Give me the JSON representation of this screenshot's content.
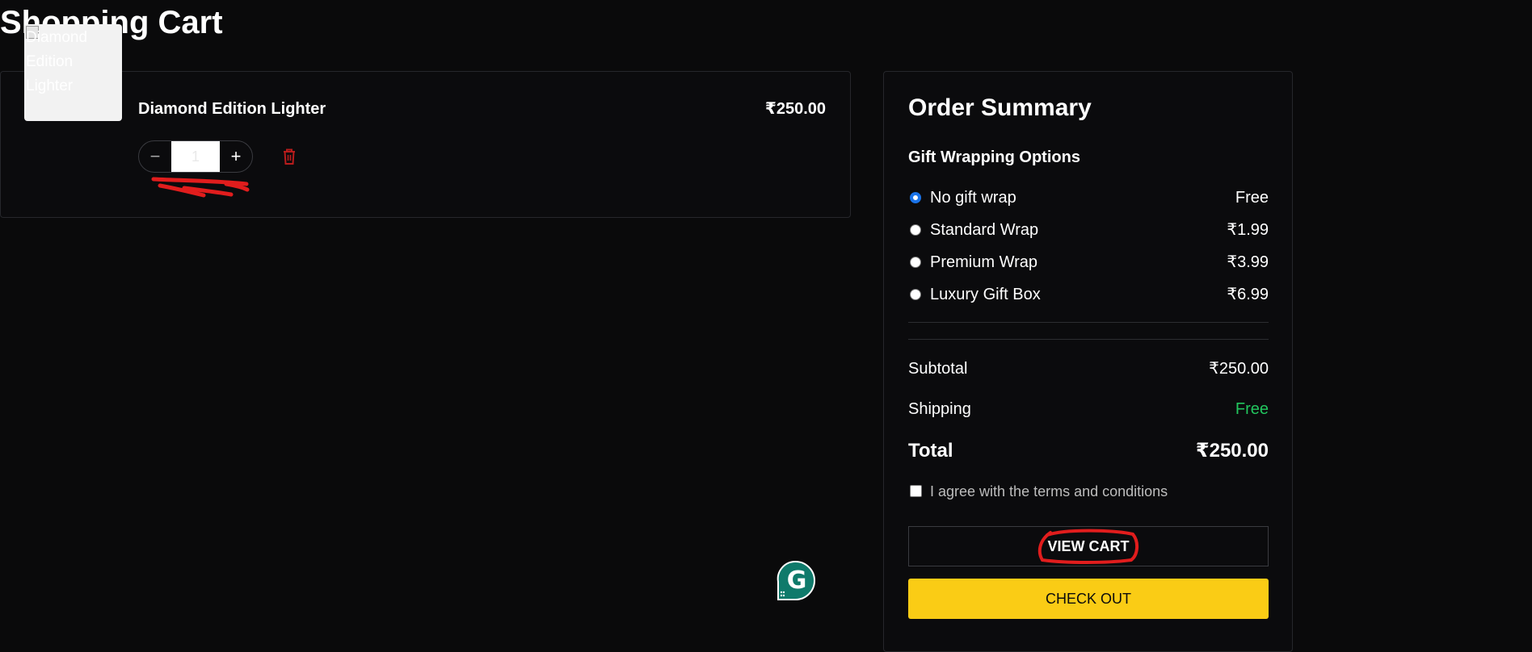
{
  "page": {
    "title": "Shopping Cart"
  },
  "cart": {
    "items": [
      {
        "image_alt": "Diamond Edition Lighter",
        "name": "Diamond Edition Lighter",
        "price": "₹250.00",
        "quantity": "1",
        "minus_symbol": "−",
        "plus_symbol": "+"
      }
    ]
  },
  "summary": {
    "title": "Order Summary",
    "gift_heading": "Gift Wrapping Options",
    "gift_options": [
      {
        "label": "No gift wrap",
        "price": "Free",
        "selected": true
      },
      {
        "label": "Standard Wrap",
        "price": "₹1.99",
        "selected": false
      },
      {
        "label": "Premium Wrap",
        "price": "₹3.99",
        "selected": false
      },
      {
        "label": "Luxury Gift Box",
        "price": "₹6.99",
        "selected": false
      }
    ],
    "subtotal_label": "Subtotal",
    "subtotal_value": "₹250.00",
    "shipping_label": "Shipping",
    "shipping_value": "Free",
    "total_label": "Total",
    "total_value": "₹250.00",
    "terms_label": "I agree with the terms and conditions",
    "terms_checked": false,
    "view_cart_label": "VIEW CART",
    "checkout_label": "CHECK OUT"
  },
  "badge": {
    "letter": "G"
  },
  "colors": {
    "background": "#0a0a0b",
    "checkout_yellow": "#facc15",
    "shipping_free_green": "#22c55e",
    "trash_red": "#b91c1c",
    "annotation_red": "#e11d1d",
    "badge_teal": "#0f7a6b",
    "radio_blue": "#1a73e8"
  },
  "icons": {
    "minus": "minus-icon",
    "plus": "plus-icon",
    "trash": "trash-icon",
    "badge": "grammarly-badge-icon",
    "broken_image": "broken-image-icon"
  }
}
